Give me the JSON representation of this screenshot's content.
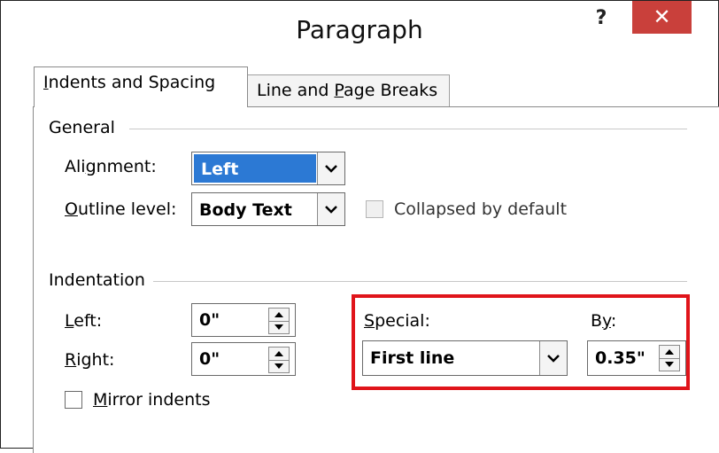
{
  "dialog": {
    "title": "Paragraph",
    "help_label": "?",
    "close_label": "✕"
  },
  "tabs": [
    {
      "label_pre": "",
      "label_ul": "I",
      "label_post": "ndents and Spacing",
      "active": true
    },
    {
      "label_pre": "Line and ",
      "label_ul": "P",
      "label_post": "age Breaks",
      "active": false
    }
  ],
  "general": {
    "group_label": "General",
    "alignment_label_pre": "Ali",
    "alignment_label_ul": "g",
    "alignment_label_post": "nment:",
    "alignment_value": "Left",
    "outline_label_pre": "",
    "outline_label_ul": "O",
    "outline_label_post": "utline level:",
    "outline_value": "Body Text",
    "collapsed_label": "Collapsed by default"
  },
  "indentation": {
    "group_label": "Indentation",
    "left_label_pre": "",
    "left_label_ul": "L",
    "left_label_post": "eft:",
    "left_value": "0\"",
    "right_label_pre": "",
    "right_label_ul": "R",
    "right_label_post": "ight:",
    "right_value": "0\"",
    "special_label_pre": "",
    "special_label_ul": "S",
    "special_label_post": "pecial:",
    "special_value": "First line",
    "by_label_pre": "B",
    "by_label_ul": "y",
    "by_label_post": ":",
    "by_value": "0.35\"",
    "mirror_label_pre": "",
    "mirror_label_ul": "M",
    "mirror_label_post": "irror indents"
  },
  "colors": {
    "close_button": "#c9403b",
    "selection": "#2c79d4",
    "highlight_box": "#e0141a"
  }
}
